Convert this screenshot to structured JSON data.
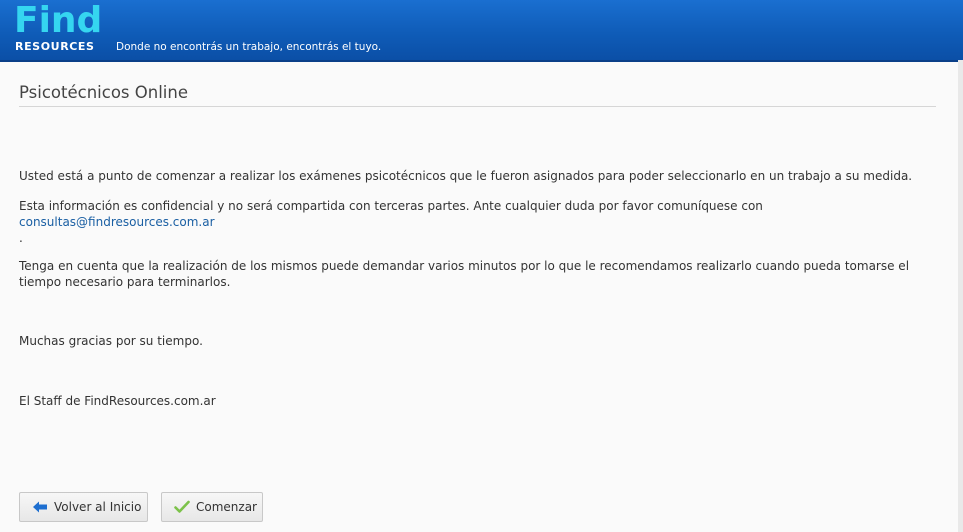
{
  "header": {
    "logo_find": "Find",
    "logo_resources": "RESOURCES",
    "tagline": "Donde no encontrás un trabajo, encontrás el tuyo."
  },
  "main": {
    "title": "Psicotécnicos Online",
    "paragraph1": "Usted está a punto de comenzar a realizar los exámenes psicotécnicos que le fueron asignados para poder seleccionarlo en un trabajo a su medida.",
    "paragraph2_text": "Esta información es confidencial y no será compartida con terceras partes. Ante cualquier duda por favor comuníquese con ",
    "paragraph2_link": "consultas@findresources.com.ar",
    "paragraph2_end": ".",
    "paragraph3": "Tenga en cuenta que la realización de los mismos puede demandar varios minutos por lo que le recomendamos realizarlo cuando pueda tomarse el tiempo necesario para terminarlos.",
    "paragraph4": "Muchas gracias por su tiempo.",
    "paragraph5": "El Staff de FindResources.com.ar"
  },
  "buttons": {
    "back_label": "Volver al Inicio",
    "back_icon": "arrow-left-icon",
    "start_label": "Comenzar",
    "start_icon": "check-icon"
  },
  "colors": {
    "header_blue": "#0f5cb8",
    "logo_cyan": "#35d6f0",
    "link": "#1a5fa3",
    "back_arrow": "#1e6fd0",
    "check": "#7cc24a"
  }
}
